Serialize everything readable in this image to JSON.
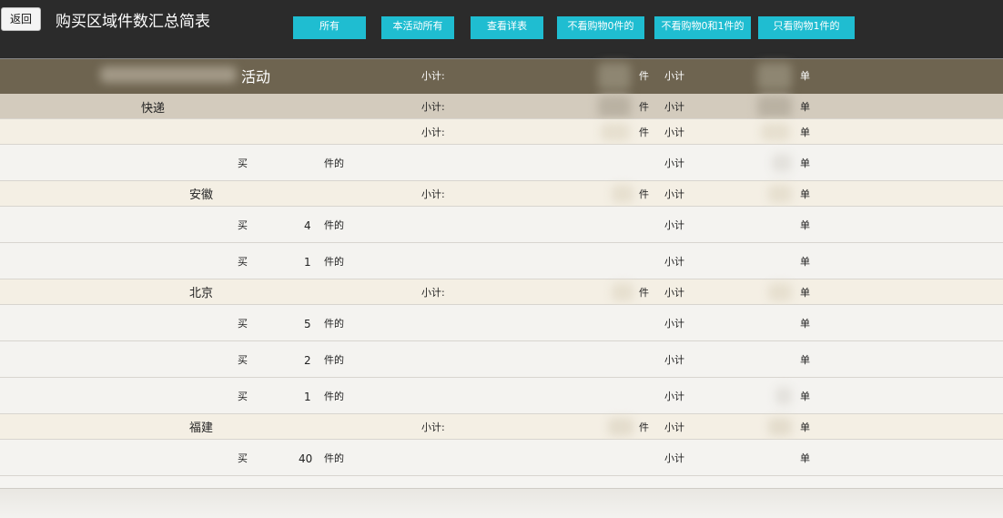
{
  "header": {
    "back_label": "返回",
    "title": "购买区域件数汇总简表",
    "filters": [
      "所有",
      "本活动所有",
      "查看详表",
      "不看购物0件的",
      "不看购物0和1件的",
      "只看购物1件的"
    ]
  },
  "labels": {
    "subtotal_colon": "小计:",
    "subtotal": "小计",
    "piece": "件",
    "order": "单",
    "buy": "买",
    "pieces_of": "件的"
  },
  "activity_row": {
    "name_suffix": "活动"
  },
  "express_row": {
    "name": "快递"
  },
  "groups": [
    {
      "region": "",
      "items": [
        {
          "qty": ""
        }
      ]
    },
    {
      "region": "安徽",
      "items": [
        {
          "qty": "4"
        },
        {
          "qty": "1"
        }
      ]
    },
    {
      "region": "北京",
      "items": [
        {
          "qty": "5"
        },
        {
          "qty": "2"
        },
        {
          "qty": "1"
        }
      ]
    },
    {
      "region": "福建",
      "items": [
        {
          "qty": "40"
        }
      ]
    }
  ],
  "colors": {
    "accent": "#1fbdd1",
    "header_bg": "#2b2b2b",
    "activity_bg": "#6e6450"
  }
}
